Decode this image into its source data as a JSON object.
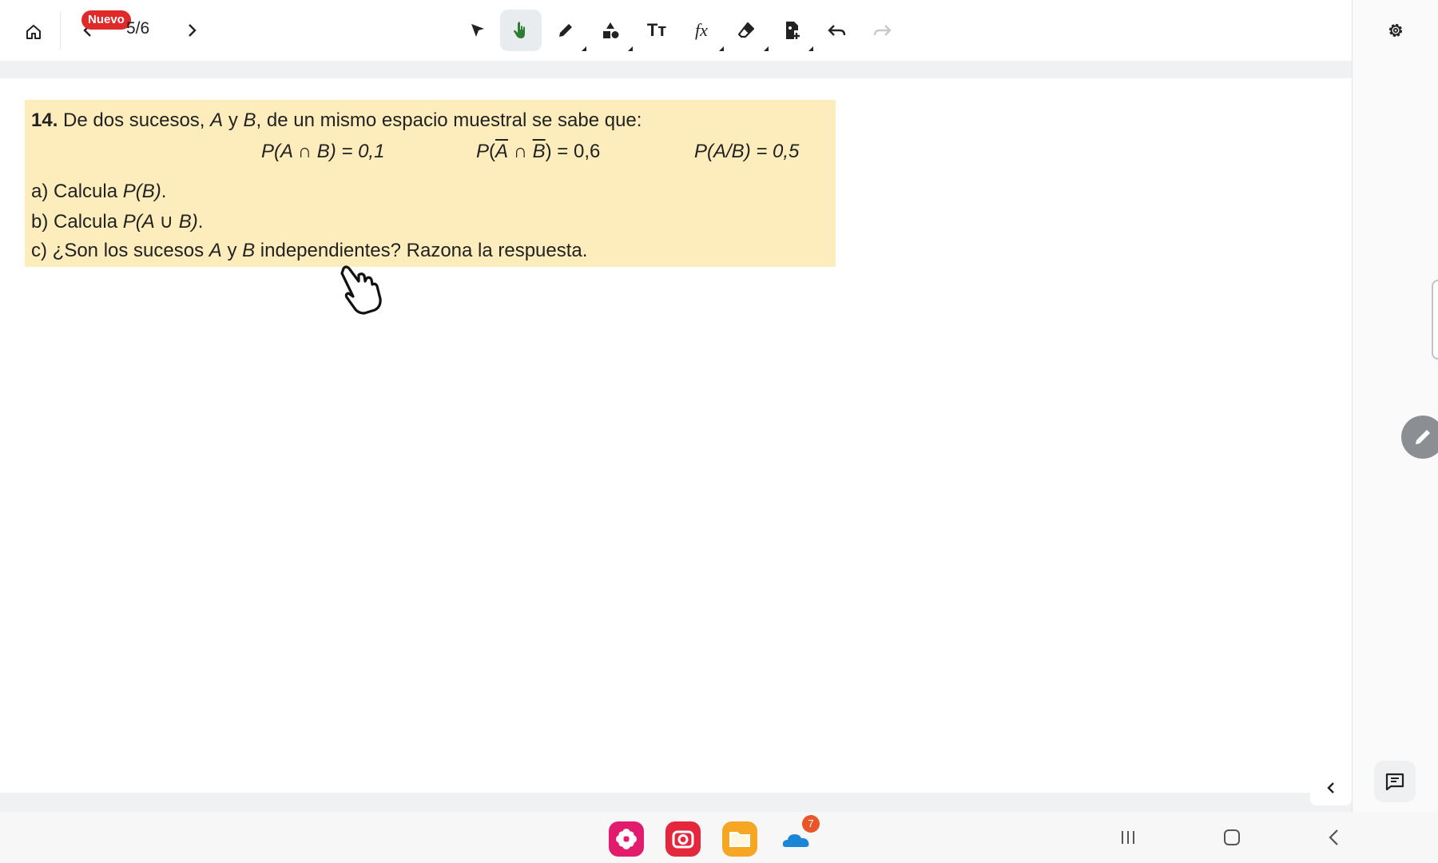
{
  "toolbar": {
    "badge": "Nuevo",
    "page_indicator": "5/6",
    "tools": [
      "home-icon",
      "chevron-left-icon",
      "chevron-right-icon",
      "pointer-icon",
      "hand-icon",
      "pencil-icon",
      "shapes-icon",
      "text-size-icon",
      "formula-icon",
      "eraser-icon",
      "insert-image-icon",
      "undo-icon",
      "redo-icon",
      "settings-icon"
    ],
    "active_tool": "hand-icon",
    "formula_label": "fx",
    "text_label": "Tт"
  },
  "exercise": {
    "number": "14.",
    "intro_pre": "De dos sucesos, ",
    "var_a": "A",
    "conj": " y ",
    "var_b": "B",
    "intro_post": ", de un mismo espacio muestral se sabe que:",
    "f1_p": "P",
    "f1_body": "(A ∩ B) = 0,1",
    "f2_p": "P",
    "f2_open": "(",
    "f2_a": "A",
    "f2_cap": " ∩ ",
    "f2_b": "B",
    "f2_close": ") = 0,6",
    "f3_p": "P",
    "f3_body": "(A/B) = 0,5",
    "a_label": "a)",
    "a_text": " Calcula ",
    "a_expr": "P(B)",
    "a_end": ".",
    "b_label": "b)",
    "b_text": " Calcula ",
    "b_expr": "P(A ∪ B)",
    "b_end": ".",
    "c_label": "c)",
    "c_text1": " ¿Son los sucesos ",
    "c_a": "A",
    "c_y": " y ",
    "c_b": "B",
    "c_text2": " independientes? Razona la respuesta."
  },
  "dock": {
    "apps": [
      "flower-app-icon",
      "camera-app-icon",
      "files-app-icon",
      "onedrive-app-icon"
    ],
    "notification_count": "7"
  },
  "colors": {
    "exercise_bg": "#fdedbd",
    "badge_red": "#e02a2a",
    "active_tool_green": "#2e7d32"
  }
}
